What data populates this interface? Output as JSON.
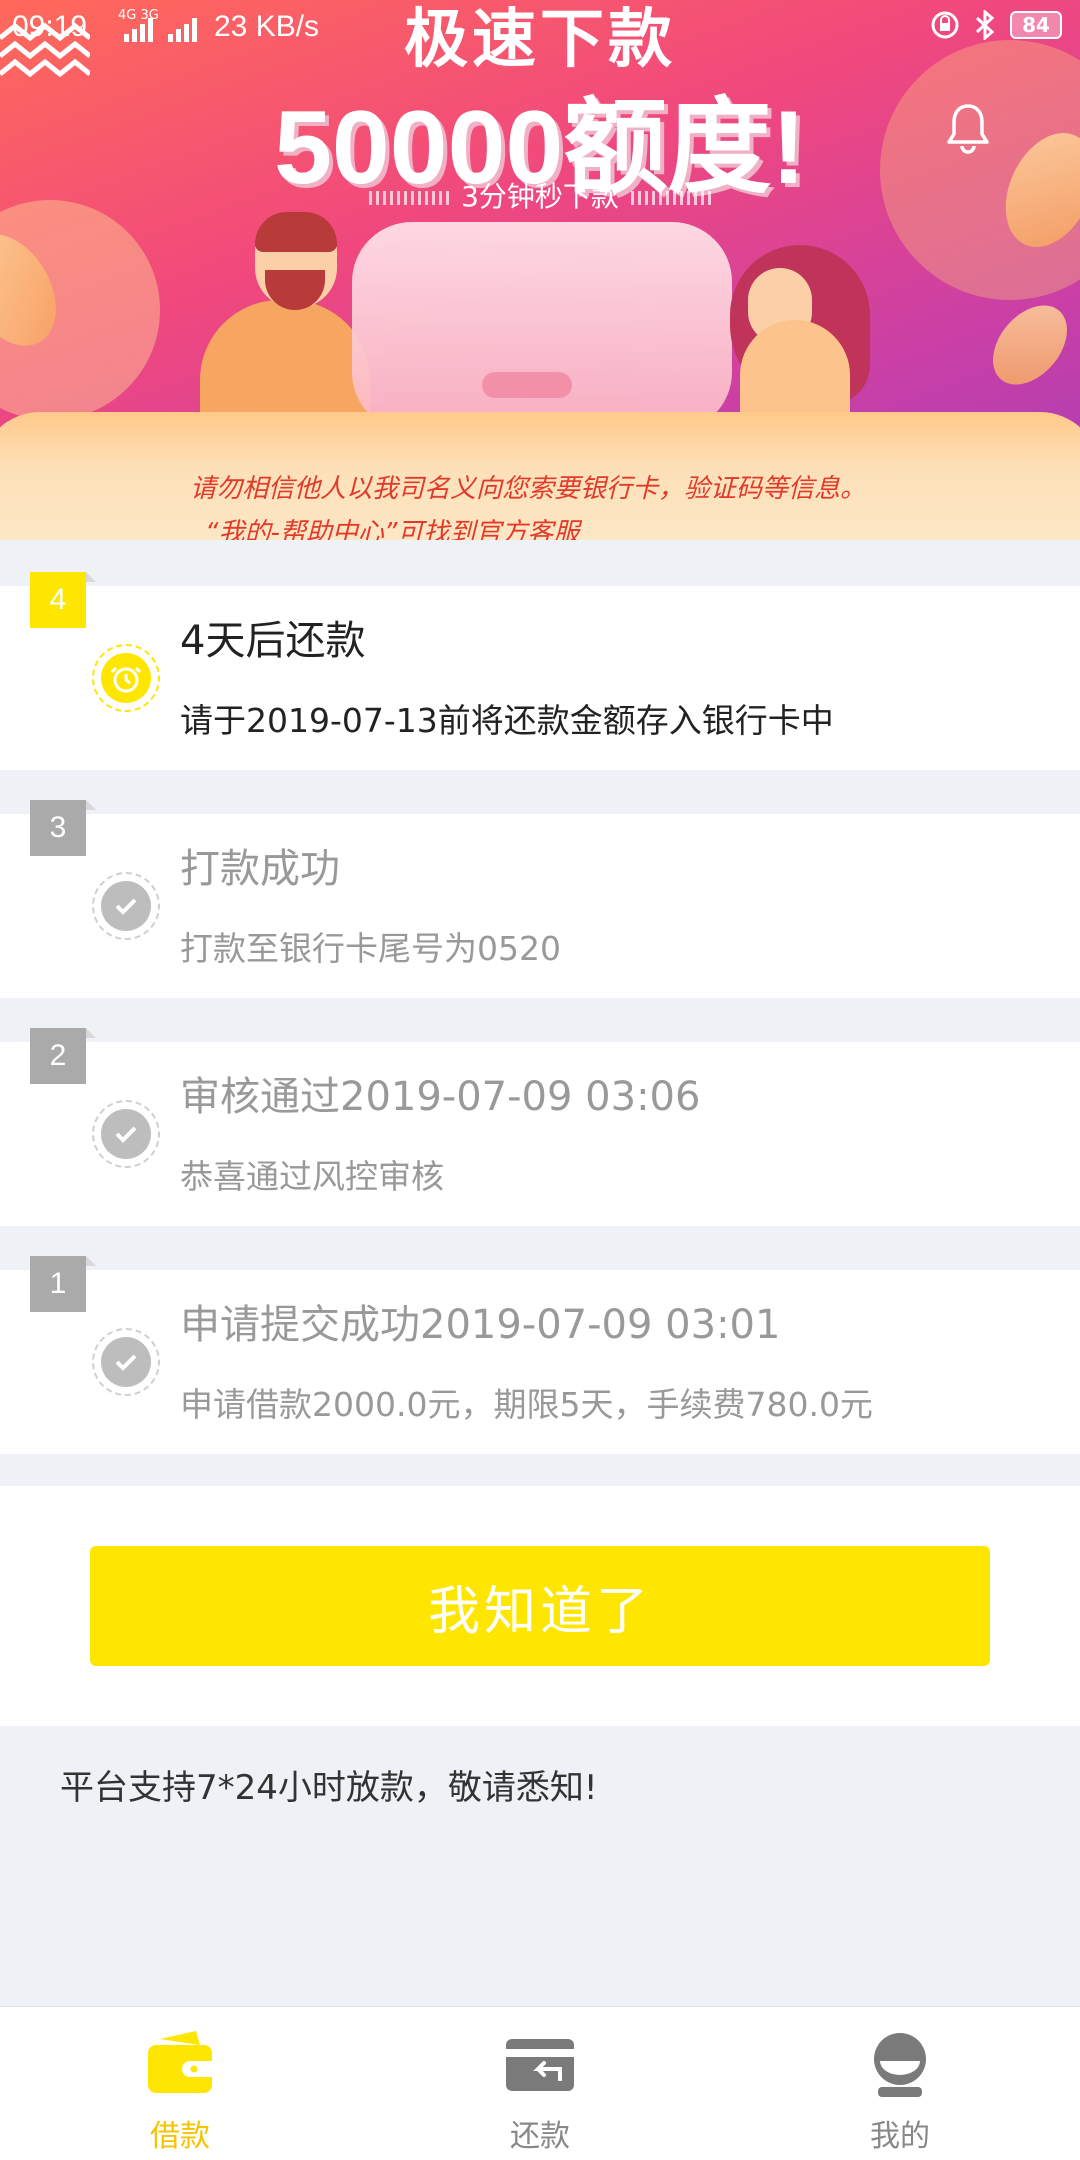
{
  "status_bar": {
    "time": "09:19",
    "network": "4G 3G",
    "speed": "23 KB/s",
    "battery": "84"
  },
  "banner": {
    "title_line1": "极速下款",
    "title_line2": "50000额度!",
    "subtitle": "3分钟秒下款",
    "warning_line1": "请勿相信他人以我司名义向您索要银行卡，验证码等信息。",
    "warning_line2": "“我的-帮助中心”可找到官方客服"
  },
  "steps": [
    {
      "number": "4",
      "title": "4天后还款",
      "desc": "请于2019-07-13前将还款金额存入银行卡中",
      "active": true
    },
    {
      "number": "3",
      "title": "打款成功",
      "desc": "打款至银行卡尾号为0520",
      "active": false
    },
    {
      "number": "2",
      "title": "审核通过2019-07-09 03:06",
      "desc": "恭喜通过风控审核",
      "active": false
    },
    {
      "number": "1",
      "title": "申请提交成功2019-07-09 03:01",
      "desc": "申请借款2000.0元，期限5天，手续费780.0元",
      "active": false
    }
  ],
  "button": {
    "label": "我知道了"
  },
  "notice": "平台支持7*24小时放款，敬请悉知!",
  "nav": [
    {
      "label": "借款",
      "icon": "wallet-icon",
      "active": true
    },
    {
      "label": "还款",
      "icon": "repay-card-icon",
      "active": false
    },
    {
      "label": "我的",
      "icon": "user-profile-icon",
      "active": false
    }
  ],
  "colors": {
    "accent": "#ffe600",
    "nav_active": "#f5c400",
    "warning_text": "#e23a2a"
  }
}
